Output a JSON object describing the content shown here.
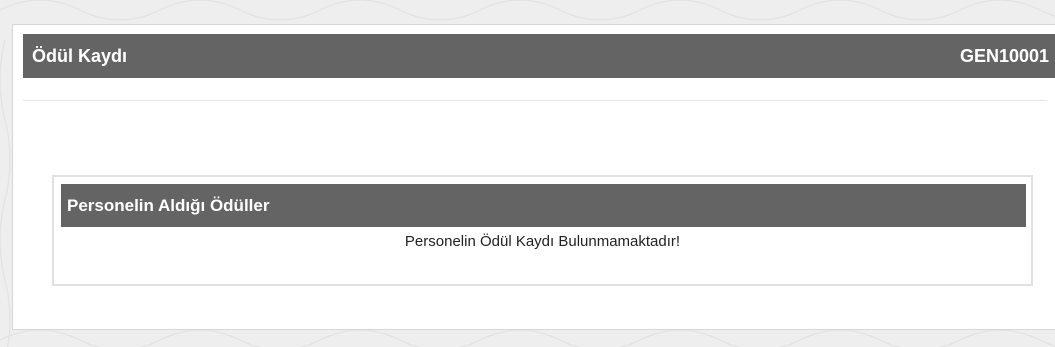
{
  "page": {
    "background_color": "#eeeeee",
    "accent_color": "#646464"
  },
  "award_record": {
    "title": "Ödül Kaydı",
    "code": "GEN10001"
  },
  "awards_section": {
    "title": "Personelin Aldığı Ödüller",
    "empty_message": "Personelin Ödül Kaydı Bulunmamaktadır!"
  }
}
